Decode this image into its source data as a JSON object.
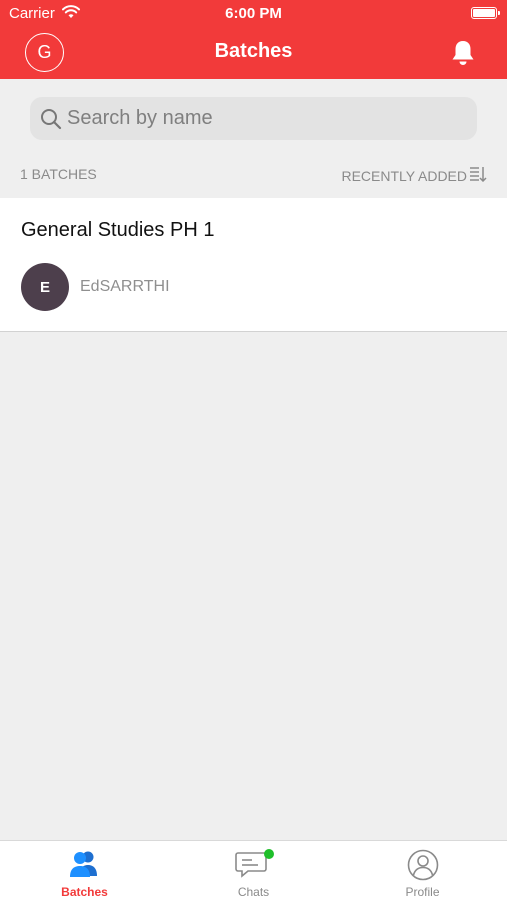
{
  "status_bar": {
    "carrier": "Carrier",
    "time": "6:00 PM"
  },
  "nav": {
    "avatar_letter": "G",
    "title": "Batches"
  },
  "search": {
    "placeholder": "Search by name",
    "value": ""
  },
  "list_meta": {
    "count_label": "1 BATCHES",
    "sort_label": "RECENTLY ADDED"
  },
  "batches": [
    {
      "title": "General Studies PH 1",
      "owner_initial": "E",
      "owner_name": "EdSARRTHI"
    }
  ],
  "tabs": [
    {
      "label": "Batches",
      "icon": "batches-icon",
      "active": true
    },
    {
      "label": "Chats",
      "icon": "chat-icon",
      "badge": true
    },
    {
      "label": "Profile",
      "icon": "profile-icon"
    }
  ],
  "colors": {
    "accent": "#f23a3a",
    "background": "#efefef",
    "chat_badge": "#1fbf2a",
    "tab_active_icon": "#1e90ff",
    "owner_avatar": "#4d3f4c"
  }
}
